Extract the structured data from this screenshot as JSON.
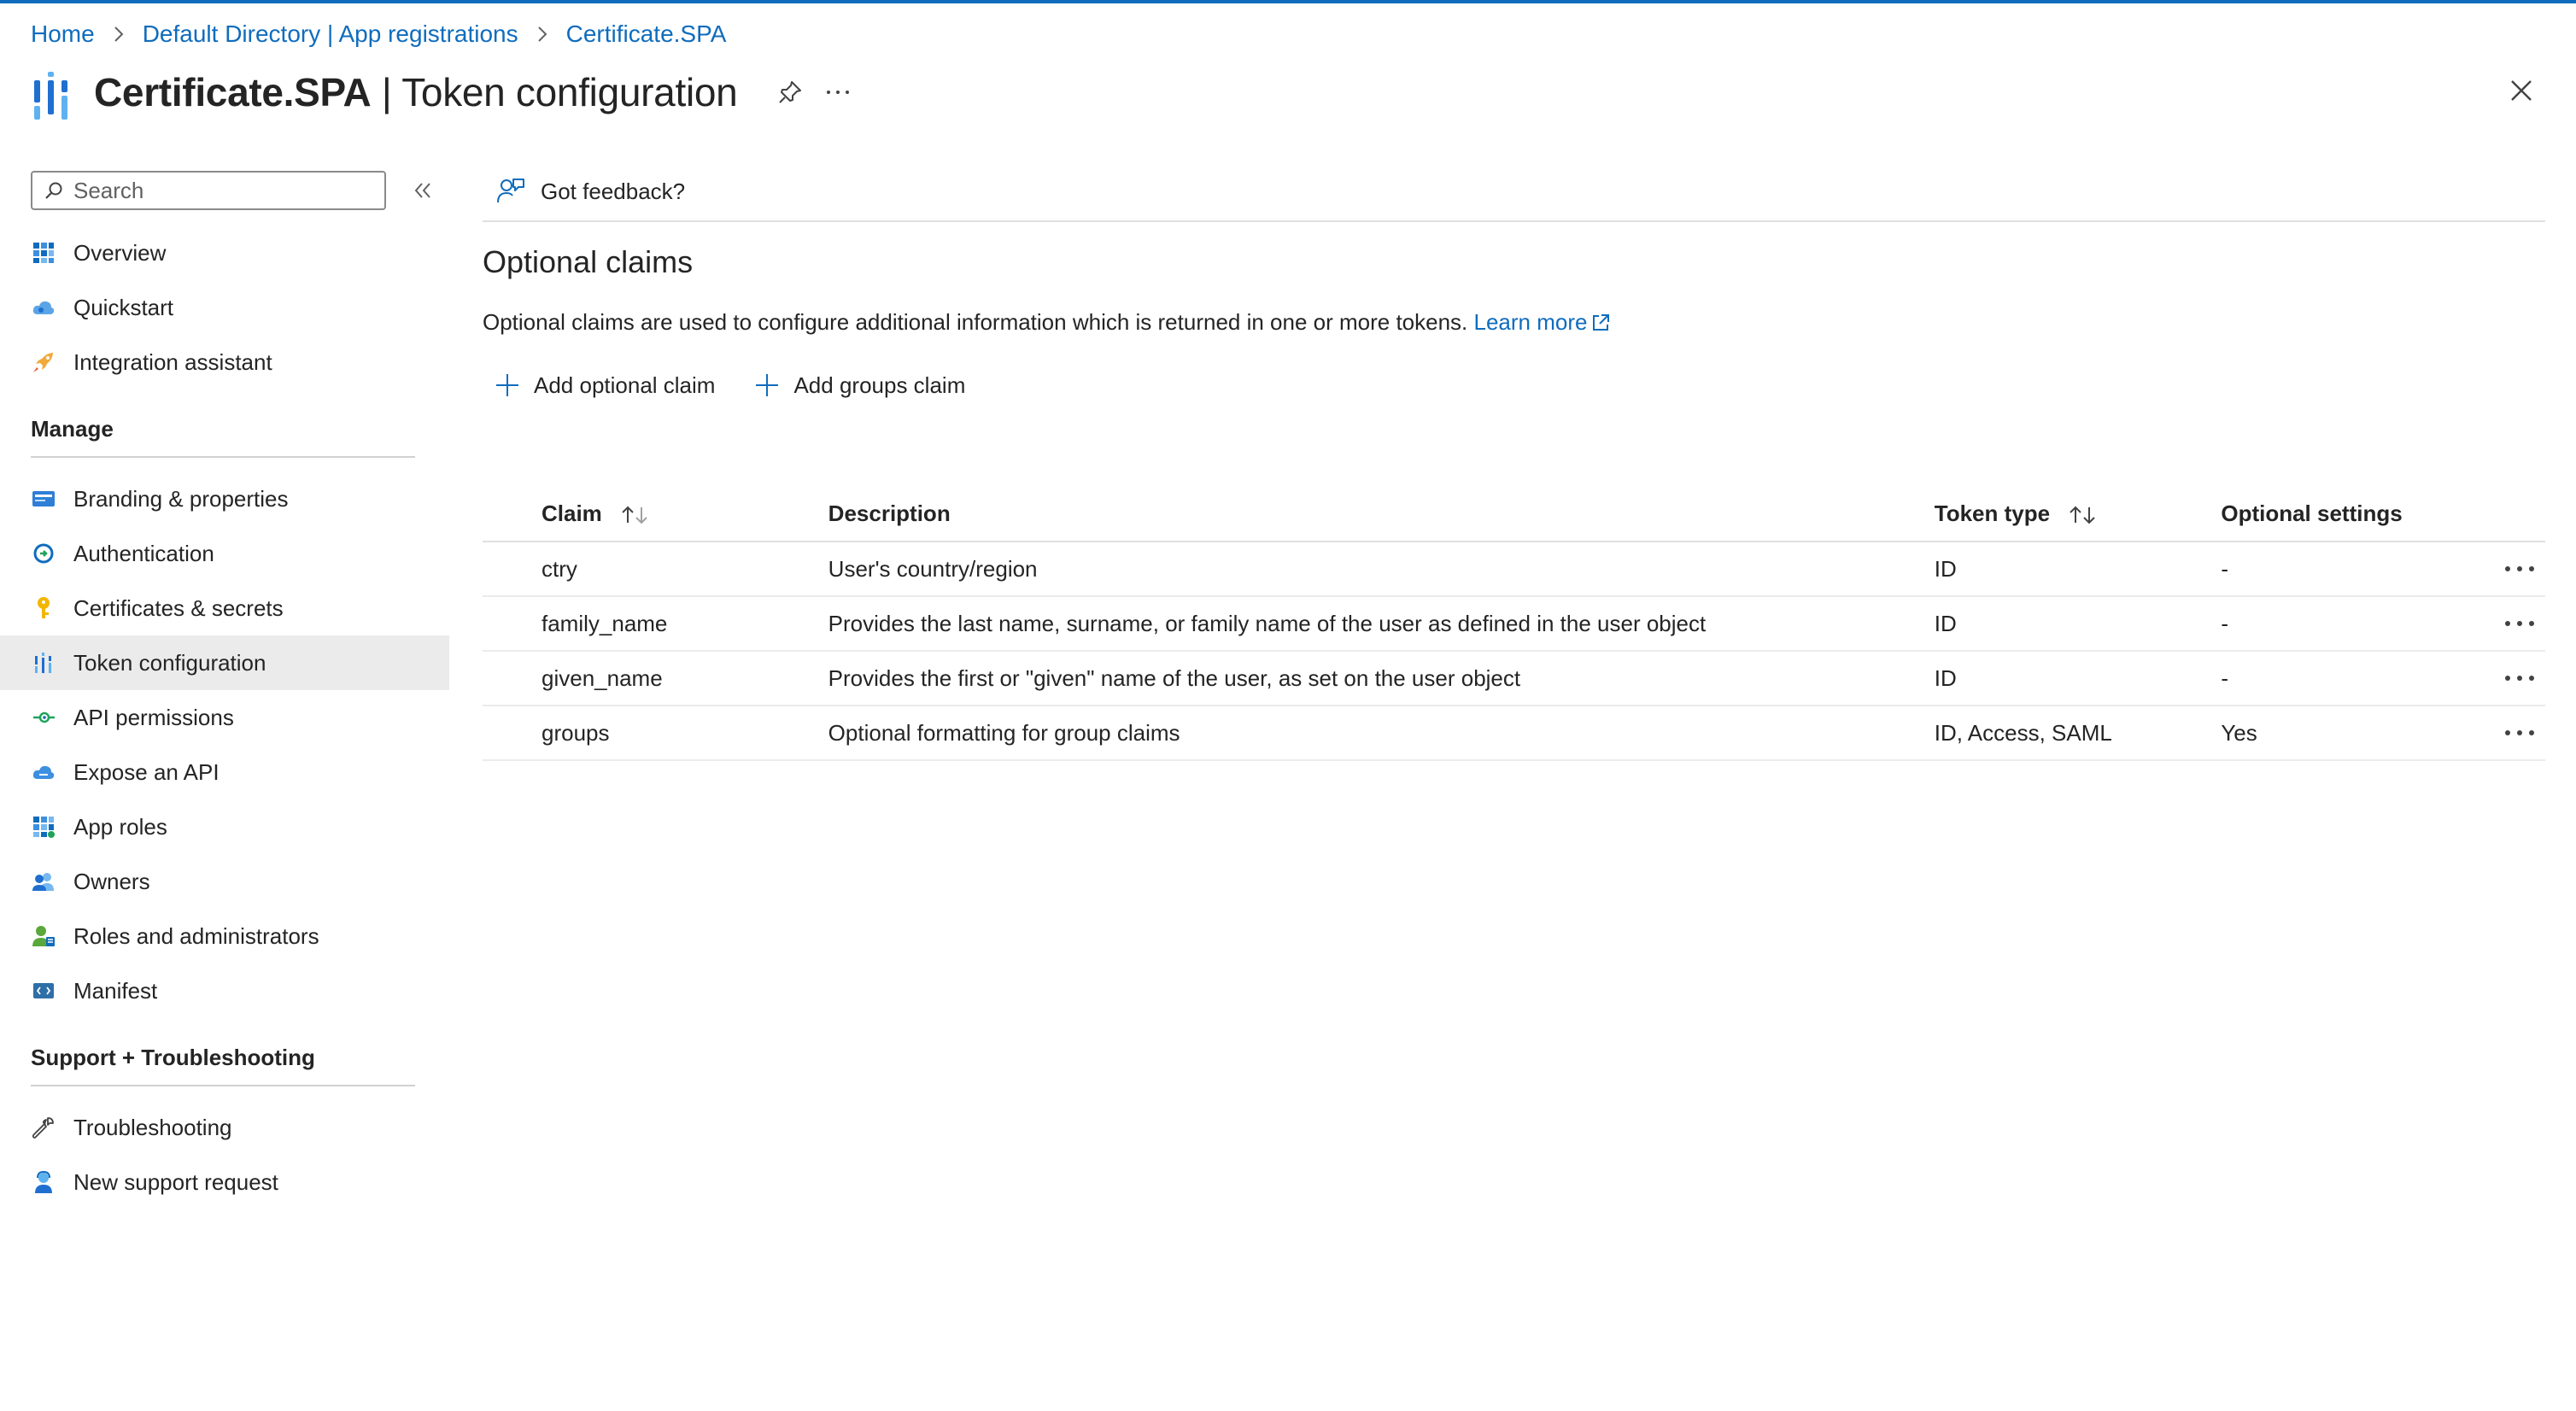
{
  "breadcrumb": [
    "Home",
    "Default Directory | App registrations",
    "Certificate.SPA"
  ],
  "header": {
    "app_name": "Certificate.SPA",
    "page_name": "| Token configuration"
  },
  "sidebar": {
    "search_placeholder": "Search",
    "top_items": [
      {
        "label": "Overview",
        "icon": "overview-grid-icon"
      },
      {
        "label": "Quickstart",
        "icon": "cloud-icon"
      },
      {
        "label": "Integration assistant",
        "icon": "rocket-icon"
      }
    ],
    "manage_heading": "Manage",
    "manage_items": [
      {
        "label": "Branding & properties",
        "icon": "branding-card-icon"
      },
      {
        "label": "Authentication",
        "icon": "authentication-icon"
      },
      {
        "label": "Certificates & secrets",
        "icon": "key-icon"
      },
      {
        "label": "Token configuration",
        "icon": "token-bars-icon",
        "active": true
      },
      {
        "label": "API permissions",
        "icon": "api-permissions-icon"
      },
      {
        "label": "Expose an API",
        "icon": "cloud-api-icon"
      },
      {
        "label": "App roles",
        "icon": "app-roles-grid-icon"
      },
      {
        "label": "Owners",
        "icon": "owners-people-icon"
      },
      {
        "label": "Roles and administrators",
        "icon": "roles-admin-icon"
      },
      {
        "label": "Manifest",
        "icon": "manifest-icon"
      }
    ],
    "support_heading": "Support + Troubleshooting",
    "support_items": [
      {
        "label": "Troubleshooting",
        "icon": "wrench-icon"
      },
      {
        "label": "New support request",
        "icon": "support-person-icon"
      }
    ]
  },
  "toolbar": {
    "feedback_label": "Got feedback?"
  },
  "optional_claims": {
    "title": "Optional claims",
    "description": "Optional claims are used to configure additional information which is returned in one or more tokens.",
    "learn_more": "Learn more",
    "add_optional_claim": "Add optional claim",
    "add_groups_claim": "Add groups claim",
    "columns": [
      "Claim",
      "Description",
      "Token type",
      "Optional settings"
    ],
    "rows": [
      {
        "claim": "ctry",
        "description": "User's country/region",
        "token_type": "ID",
        "optional_settings": "-"
      },
      {
        "claim": "family_name",
        "description": "Provides the last name, surname, or family name of the user as defined in the user object",
        "token_type": "ID",
        "optional_settings": "-"
      },
      {
        "claim": "given_name",
        "description": "Provides the first or \"given\" name of the user, as set on the user object",
        "token_type": "ID",
        "optional_settings": "-"
      },
      {
        "claim": "groups",
        "description": "Optional formatting for group claims",
        "token_type": "ID, Access, SAML",
        "optional_settings": "Yes"
      }
    ]
  },
  "colors": {
    "accent": "#0f6cbd",
    "active_nav_bg": "#ebebeb",
    "text": "#242424"
  }
}
